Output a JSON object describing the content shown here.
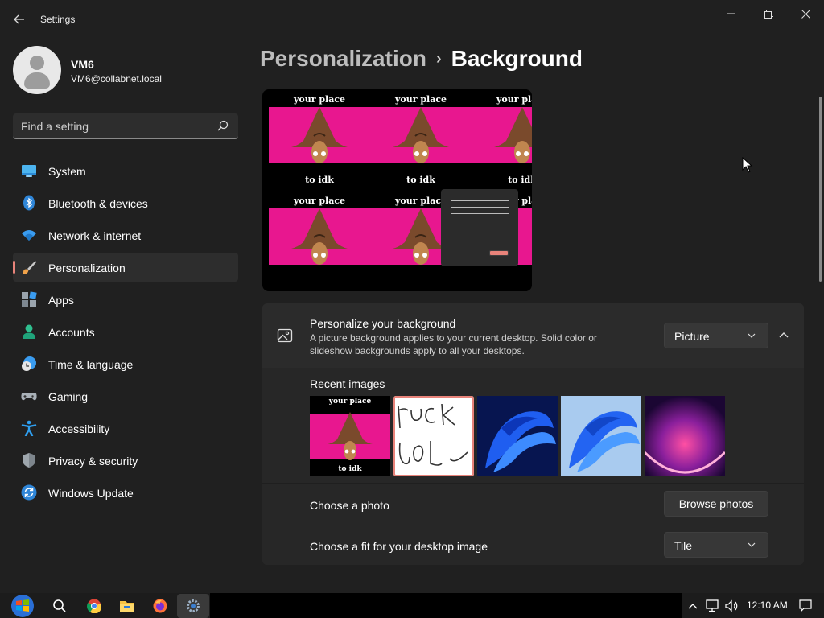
{
  "window": {
    "title": "Settings",
    "back_icon": "back-arrow-icon",
    "controls": [
      "minimize-icon",
      "restore-icon",
      "close-icon"
    ]
  },
  "profile": {
    "name": "VM6",
    "email": "VM6@collabnet.local"
  },
  "search": {
    "placeholder": "Find a setting"
  },
  "nav": {
    "items": [
      {
        "label": "System",
        "icon": "system-icon"
      },
      {
        "label": "Bluetooth & devices",
        "icon": "bluetooth-icon"
      },
      {
        "label": "Network & internet",
        "icon": "wifi-icon"
      },
      {
        "label": "Personalization",
        "icon": "brush-icon",
        "active": true
      },
      {
        "label": "Apps",
        "icon": "apps-icon"
      },
      {
        "label": "Accounts",
        "icon": "person-icon"
      },
      {
        "label": "Time & language",
        "icon": "clock-globe-icon"
      },
      {
        "label": "Gaming",
        "icon": "gamepad-icon"
      },
      {
        "label": "Accessibility",
        "icon": "accessibility-icon"
      },
      {
        "label": "Privacy & security",
        "icon": "shield-icon"
      },
      {
        "label": "Windows Update",
        "icon": "update-icon"
      }
    ]
  },
  "breadcrumb": {
    "parent": "Personalization",
    "separator": "›",
    "current": "Background"
  },
  "preview": {
    "text_top": "your place",
    "text_bottom": "to idk"
  },
  "background_card": {
    "title": "Personalize your background",
    "description": "A picture background applies to your current desktop. Solid color or slideshow backgrounds apply to all your desktops.",
    "dropdown_value": "Picture",
    "recent_label": "Recent images",
    "recent_images": [
      {
        "name": "wizard-meme",
        "text_top": "your place",
        "text_bottom": "to idk"
      },
      {
        "name": "handwriting",
        "selected": true
      },
      {
        "name": "windows-bloom-dark"
      },
      {
        "name": "windows-bloom-light"
      },
      {
        "name": "purple-glow"
      }
    ],
    "choose_photo_label": "Choose a photo",
    "browse_button": "Browse photos",
    "fit_label": "Choose a fit for your desktop image",
    "fit_value": "Tile"
  },
  "taskbar": {
    "time": "12:10 AM",
    "apps": [
      "start-icon",
      "search-icon",
      "chrome-icon",
      "file-explorer-icon",
      "firefox-icon",
      "settings-icon"
    ]
  },
  "colors": {
    "accent": "#e8837a",
    "background": "#202020",
    "card": "#2b2b2b",
    "meme_pink": "#e8178f"
  }
}
